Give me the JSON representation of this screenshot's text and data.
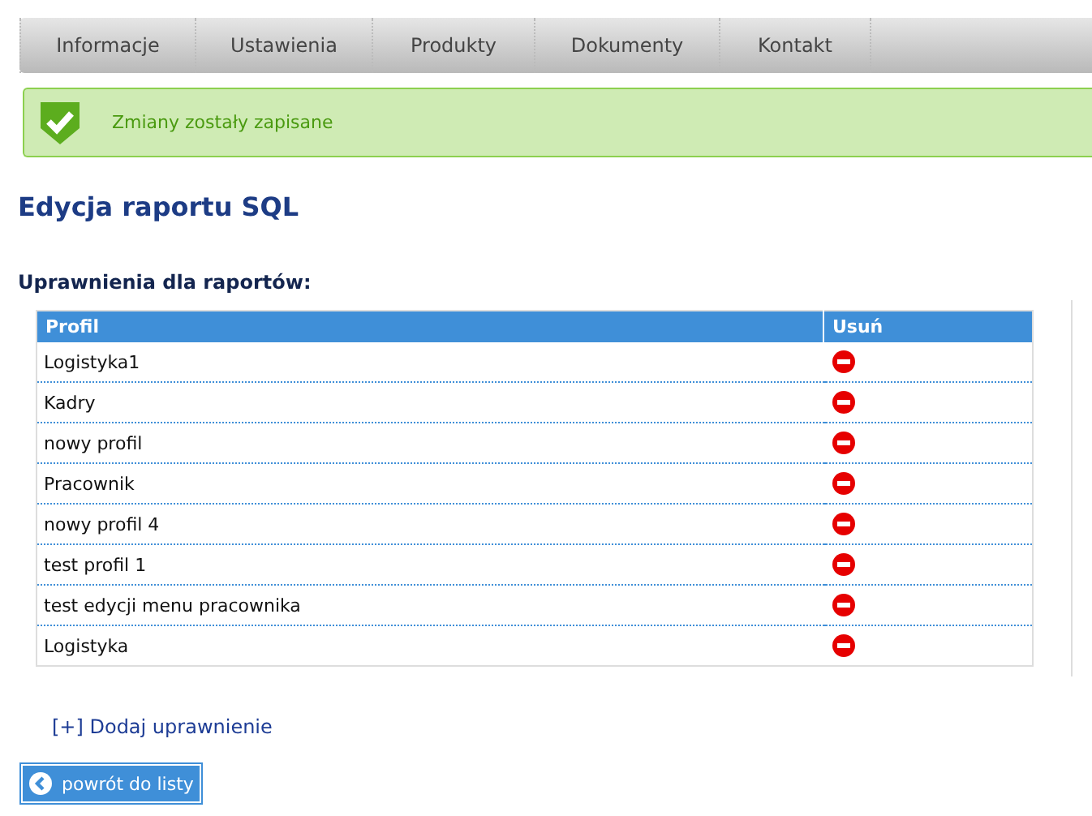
{
  "tabs": [
    {
      "label": "Informacje"
    },
    {
      "label": "Ustawienia"
    },
    {
      "label": "Produkty"
    },
    {
      "label": "Dokumenty"
    },
    {
      "label": "Kontakt"
    }
  ],
  "message": {
    "text": "Zmiany zostały zapisane"
  },
  "title": "Edycja raportu SQL",
  "section_title": "Uprawnienia dla raportów:",
  "table": {
    "columns": [
      "Profil",
      "Usuń"
    ],
    "rows": [
      {
        "profile": "Logistyka1"
      },
      {
        "profile": "Kadry"
      },
      {
        "profile": "nowy profil"
      },
      {
        "profile": "Pracownik"
      },
      {
        "profile": "nowy profil 4"
      },
      {
        "profile": "test profil 1"
      },
      {
        "profile": "test edycji menu pracownika"
      },
      {
        "profile": "Logistyka"
      }
    ]
  },
  "add_link": "[+] Dodaj uprawnienie",
  "back_button": "powrót do listy"
}
